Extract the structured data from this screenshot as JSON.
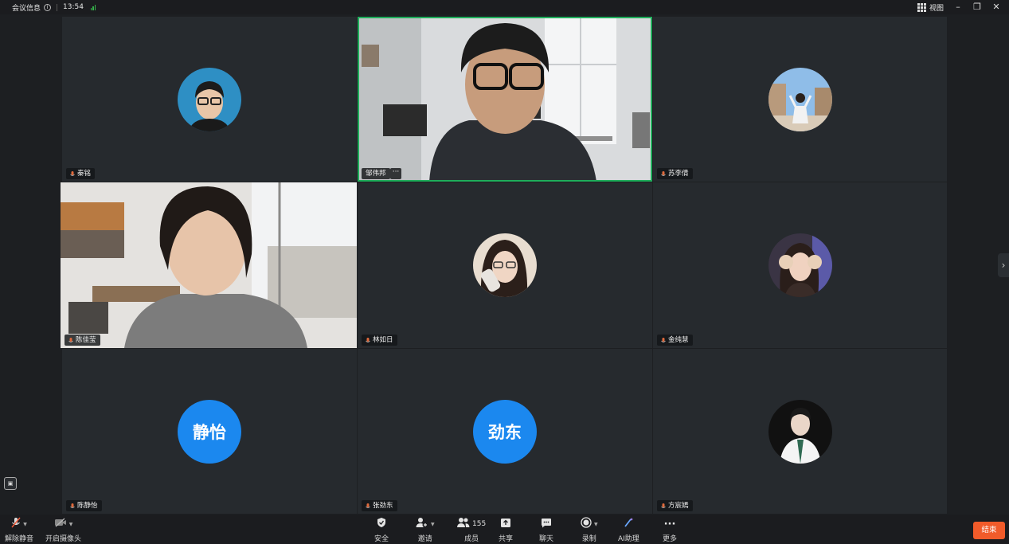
{
  "topbar": {
    "meeting_info": "会议信息",
    "time": "13:54",
    "view_label": "视图"
  },
  "participants": [
    {
      "name": "秦铭",
      "type": "avatar-photo",
      "active": false
    },
    {
      "name": "邹伟邦",
      "type": "video",
      "active": true
    },
    {
      "name": "苏李倩",
      "type": "avatar-photo",
      "active": false
    },
    {
      "name": "陈佳莹",
      "type": "video",
      "active": false
    },
    {
      "name": "林如日",
      "type": "avatar-photo",
      "active": false
    },
    {
      "name": "金纯慧",
      "type": "avatar-photo",
      "active": false
    },
    {
      "name": "陈静怡",
      "type": "avatar-text",
      "avatar_text": "静怡",
      "active": false
    },
    {
      "name": "张劲东",
      "type": "avatar-text",
      "avatar_text": "劲东",
      "active": false
    },
    {
      "name": "方宸嫣",
      "type": "avatar-photo",
      "active": false
    }
  ],
  "more_glyph": "···",
  "toolbar": {
    "unmute": "解除静音",
    "start_video": "开启摄像头",
    "security": "安全",
    "invite": "邀请",
    "members": "成员",
    "members_count": "155",
    "share": "共享",
    "chat": "聊天",
    "record": "录制",
    "ai_assistant": "AI助理",
    "more": "更多",
    "end": "结束"
  },
  "colors": {
    "accent_blue": "#1b88ef",
    "active_speaker": "#1fad5b",
    "end_button": "#f15b2a"
  }
}
